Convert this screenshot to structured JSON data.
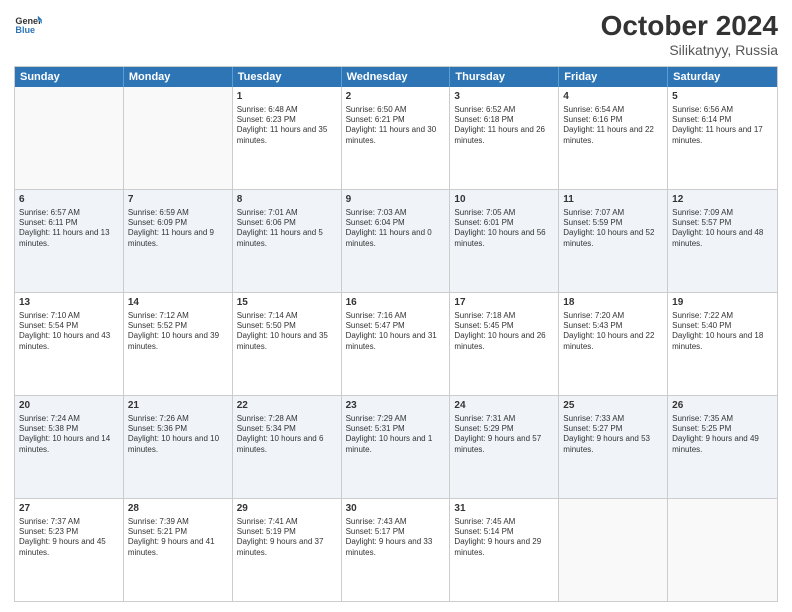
{
  "header": {
    "logo_line1": "General",
    "logo_line2": "Blue",
    "month": "October 2024",
    "location": "Silikatnyy, Russia"
  },
  "weekdays": [
    "Sunday",
    "Monday",
    "Tuesday",
    "Wednesday",
    "Thursday",
    "Friday",
    "Saturday"
  ],
  "rows": [
    [
      {
        "day": "",
        "empty": true
      },
      {
        "day": "",
        "empty": true
      },
      {
        "day": "1",
        "sunrise": "6:48 AM",
        "sunset": "6:23 PM",
        "daylight": "11 hours and 35 minutes."
      },
      {
        "day": "2",
        "sunrise": "6:50 AM",
        "sunset": "6:21 PM",
        "daylight": "11 hours and 30 minutes."
      },
      {
        "day": "3",
        "sunrise": "6:52 AM",
        "sunset": "6:18 PM",
        "daylight": "11 hours and 26 minutes."
      },
      {
        "day": "4",
        "sunrise": "6:54 AM",
        "sunset": "6:16 PM",
        "daylight": "11 hours and 22 minutes."
      },
      {
        "day": "5",
        "sunrise": "6:56 AM",
        "sunset": "6:14 PM",
        "daylight": "11 hours and 17 minutes."
      }
    ],
    [
      {
        "day": "6",
        "sunrise": "6:57 AM",
        "sunset": "6:11 PM",
        "daylight": "11 hours and 13 minutes."
      },
      {
        "day": "7",
        "sunrise": "6:59 AM",
        "sunset": "6:09 PM",
        "daylight": "11 hours and 9 minutes."
      },
      {
        "day": "8",
        "sunrise": "7:01 AM",
        "sunset": "6:06 PM",
        "daylight": "11 hours and 5 minutes."
      },
      {
        "day": "9",
        "sunrise": "7:03 AM",
        "sunset": "6:04 PM",
        "daylight": "11 hours and 0 minutes."
      },
      {
        "day": "10",
        "sunrise": "7:05 AM",
        "sunset": "6:01 PM",
        "daylight": "10 hours and 56 minutes."
      },
      {
        "day": "11",
        "sunrise": "7:07 AM",
        "sunset": "5:59 PM",
        "daylight": "10 hours and 52 minutes."
      },
      {
        "day": "12",
        "sunrise": "7:09 AM",
        "sunset": "5:57 PM",
        "daylight": "10 hours and 48 minutes."
      }
    ],
    [
      {
        "day": "13",
        "sunrise": "7:10 AM",
        "sunset": "5:54 PM",
        "daylight": "10 hours and 43 minutes."
      },
      {
        "day": "14",
        "sunrise": "7:12 AM",
        "sunset": "5:52 PM",
        "daylight": "10 hours and 39 minutes."
      },
      {
        "day": "15",
        "sunrise": "7:14 AM",
        "sunset": "5:50 PM",
        "daylight": "10 hours and 35 minutes."
      },
      {
        "day": "16",
        "sunrise": "7:16 AM",
        "sunset": "5:47 PM",
        "daylight": "10 hours and 31 minutes."
      },
      {
        "day": "17",
        "sunrise": "7:18 AM",
        "sunset": "5:45 PM",
        "daylight": "10 hours and 26 minutes."
      },
      {
        "day": "18",
        "sunrise": "7:20 AM",
        "sunset": "5:43 PM",
        "daylight": "10 hours and 22 minutes."
      },
      {
        "day": "19",
        "sunrise": "7:22 AM",
        "sunset": "5:40 PM",
        "daylight": "10 hours and 18 minutes."
      }
    ],
    [
      {
        "day": "20",
        "sunrise": "7:24 AM",
        "sunset": "5:38 PM",
        "daylight": "10 hours and 14 minutes."
      },
      {
        "day": "21",
        "sunrise": "7:26 AM",
        "sunset": "5:36 PM",
        "daylight": "10 hours and 10 minutes."
      },
      {
        "day": "22",
        "sunrise": "7:28 AM",
        "sunset": "5:34 PM",
        "daylight": "10 hours and 6 minutes."
      },
      {
        "day": "23",
        "sunrise": "7:29 AM",
        "sunset": "5:31 PM",
        "daylight": "10 hours and 1 minute."
      },
      {
        "day": "24",
        "sunrise": "7:31 AM",
        "sunset": "5:29 PM",
        "daylight": "9 hours and 57 minutes."
      },
      {
        "day": "25",
        "sunrise": "7:33 AM",
        "sunset": "5:27 PM",
        "daylight": "9 hours and 53 minutes."
      },
      {
        "day": "26",
        "sunrise": "7:35 AM",
        "sunset": "5:25 PM",
        "daylight": "9 hours and 49 minutes."
      }
    ],
    [
      {
        "day": "27",
        "sunrise": "7:37 AM",
        "sunset": "5:23 PM",
        "daylight": "9 hours and 45 minutes."
      },
      {
        "day": "28",
        "sunrise": "7:39 AM",
        "sunset": "5:21 PM",
        "daylight": "9 hours and 41 minutes."
      },
      {
        "day": "29",
        "sunrise": "7:41 AM",
        "sunset": "5:19 PM",
        "daylight": "9 hours and 37 minutes."
      },
      {
        "day": "30",
        "sunrise": "7:43 AM",
        "sunset": "5:17 PM",
        "daylight": "9 hours and 33 minutes."
      },
      {
        "day": "31",
        "sunrise": "7:45 AM",
        "sunset": "5:14 PM",
        "daylight": "9 hours and 29 minutes."
      },
      {
        "day": "",
        "empty": true
      },
      {
        "day": "",
        "empty": true
      }
    ]
  ]
}
